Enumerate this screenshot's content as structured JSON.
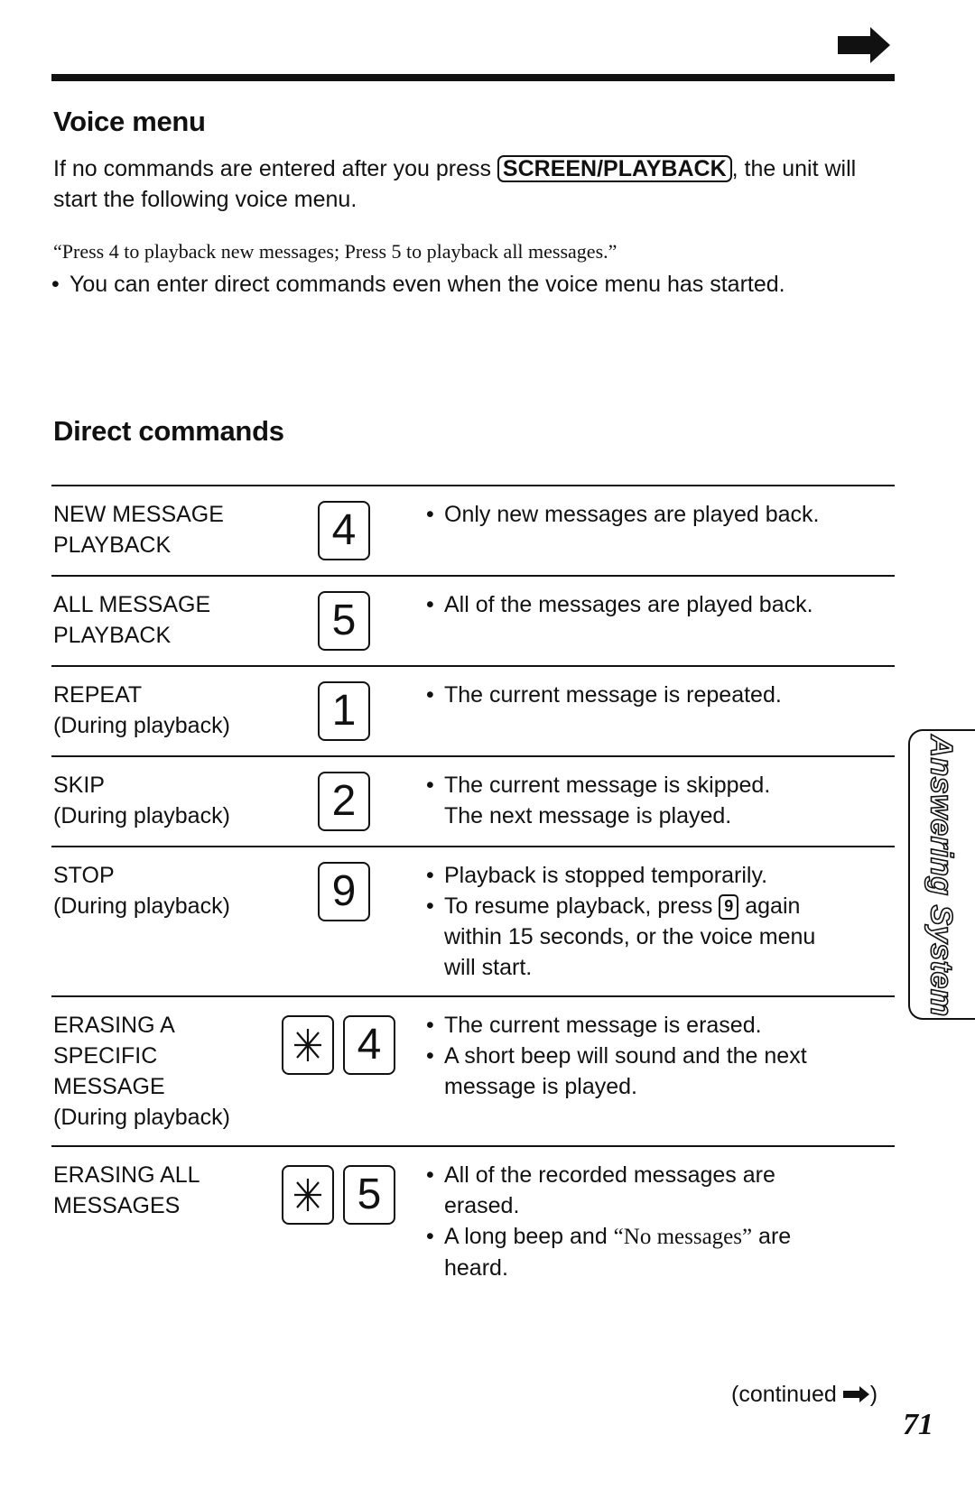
{
  "header": {
    "next_page_icon": "right-arrow-icon"
  },
  "voice_menu": {
    "title": "Voice menu",
    "intro_before": "If no commands are entered after you press ",
    "intro_key": "SCREEN/PLAYBACK",
    "intro_after": ", the unit will start the following voice menu.",
    "quote": "“Press 4 to playback new messages; Press 5 to playback all messages.”",
    "note": "You can enter direct commands even when the voice menu has started."
  },
  "direct_commands": {
    "title": "Direct commands",
    "rows": [
      {
        "label": "NEW MESSAGE PLAYBACK",
        "keys": [
          "4"
        ],
        "bullets": [
          "Only new messages are played back."
        ]
      },
      {
        "label": "ALL MESSAGE PLAYBACK",
        "keys": [
          "5"
        ],
        "bullets": [
          "All of the messages are played back."
        ]
      },
      {
        "label": "REPEAT",
        "sublabel": "(During playback)",
        "keys": [
          "1"
        ],
        "bullets": [
          "The current message is repeated."
        ]
      },
      {
        "label": "SKIP",
        "sublabel": "(During playback)",
        "keys": [
          "2"
        ],
        "bullets": [
          "The current message is skipped. The next message is played."
        ]
      },
      {
        "label": "STOP",
        "sublabel": "(During playback)",
        "keys": [
          "9"
        ],
        "bullets": [
          "Playback is stopped temporarily.",
          {
            "before": "To resume playback, press ",
            "key": "9",
            "after": " again within 15 seconds, or the voice menu will start."
          }
        ]
      },
      {
        "label": "ERASING A SPECIFIC MESSAGE",
        "sublabel": "(During playback)",
        "keys": [
          "✳",
          "4"
        ],
        "bullets": [
          "The current message is erased.",
          "A short beep will sound and the next message is played."
        ]
      },
      {
        "label": "ERASING ALL MESSAGES",
        "keys": [
          "✳",
          "5"
        ],
        "bullets": [
          "All of the recorded messages are erased.",
          {
            "before": "A long beep and ",
            "quoted": "“No messages”",
            "after": " are heard."
          }
        ]
      }
    ]
  },
  "side_tab": {
    "label": "Answering System"
  },
  "footer": {
    "continued": "(continued",
    "continued_close": ")",
    "page_number": "71"
  }
}
